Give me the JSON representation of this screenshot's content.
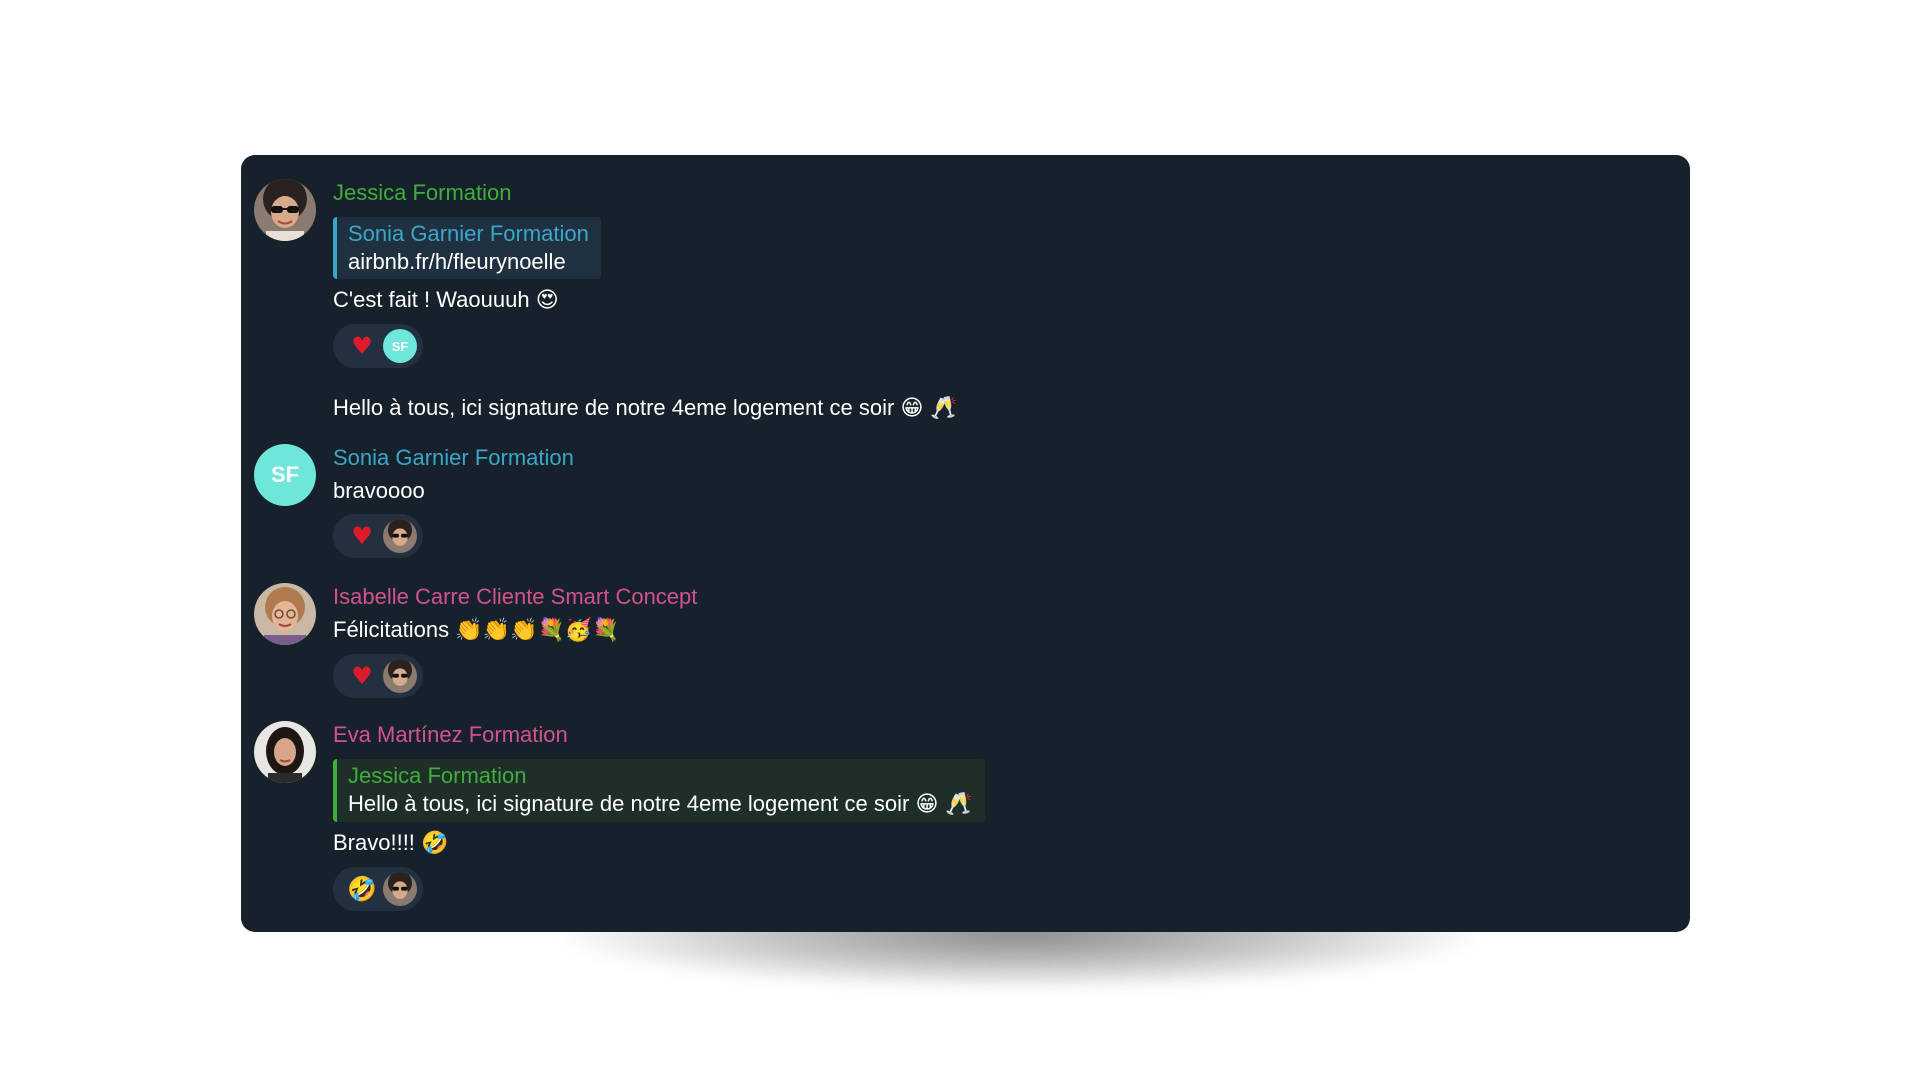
{
  "colors": {
    "panel_bg": "#17212b",
    "jessica": "#3fae3a",
    "sonia": "#3aa7c8",
    "isabelle": "#d2538b",
    "eva": "#d2538b",
    "heart": "#e0192b",
    "initials_bg": "#6ee6d9"
  },
  "messages": [
    {
      "sender": "Jessica Formation",
      "quote": {
        "sender": "Sonia Garnier Formation",
        "text": "airbnb.fr/h/fleurynoelle"
      },
      "text": "C'est fait ! Waouuuh",
      "text_emoji": "😍",
      "reaction": {
        "emoji": "♥",
        "by": "SF"
      }
    },
    {
      "text": "Hello à tous, ici signature de notre 4eme logement ce soir",
      "text_emoji": "😁 🥂"
    },
    {
      "sender": "Sonia Garnier Formation",
      "avatar_initials": "SF",
      "text": "bravoooo",
      "reaction": {
        "emoji": "♥"
      }
    },
    {
      "sender": "Isabelle Carre Cliente Smart Concept",
      "text": "Félicitations",
      "text_emoji": "👏👏👏💐🥳💐",
      "reaction": {
        "emoji": "♥"
      }
    },
    {
      "sender": "Eva Martínez Formation",
      "quote": {
        "sender": "Jessica Formation",
        "text": "Hello à tous, ici signature de notre 4eme logement ce soir",
        "text_emoji": "😁 🥂"
      },
      "text": "Bravo!!!!",
      "text_emoji": "🤣",
      "reaction": {
        "emoji": "🤣"
      }
    }
  ]
}
